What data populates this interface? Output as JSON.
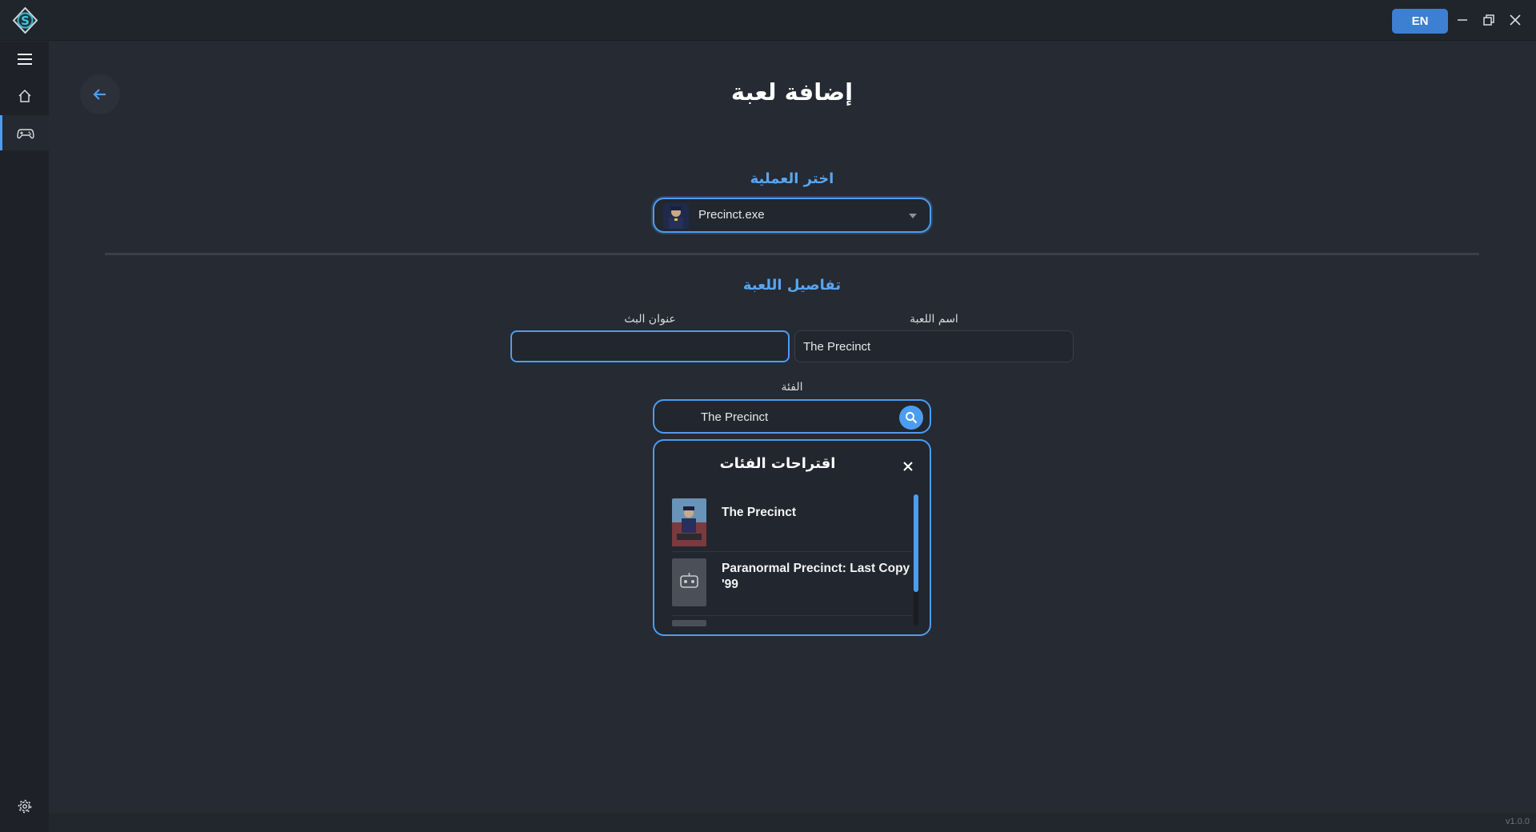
{
  "titlebar": {
    "language_button": "EN"
  },
  "sidebar": {
    "items": [
      {
        "name": "menu",
        "icon": "hamburger-icon"
      },
      {
        "name": "home",
        "icon": "home-icon"
      },
      {
        "name": "games",
        "icon": "gamepad-icon",
        "active": true
      }
    ],
    "settings_icon": "gear-icon"
  },
  "page": {
    "title": "إضافة لعبة"
  },
  "process_section": {
    "label": "اختر العملية",
    "selected_process": "Precinct.exe"
  },
  "details_section": {
    "label": "تفاصيل اللعبة",
    "game_name_label": "اسم اللعبة",
    "game_name_value": "The Precinct",
    "stream_title_label": "عنوان البث",
    "stream_title_value": "",
    "category_label": "الفئة",
    "category_value": "The Precinct"
  },
  "suggestions": {
    "title": "اقتراحات الفئات",
    "items": [
      {
        "name": "The Precinct"
      },
      {
        "name": "Paranormal Precinct: Last Copy '99"
      }
    ]
  },
  "footer": {
    "version": "v1.0.0"
  },
  "colors": {
    "accent": "#4c9df0",
    "background": "#252a33",
    "language_button": "#3d7fd0"
  }
}
